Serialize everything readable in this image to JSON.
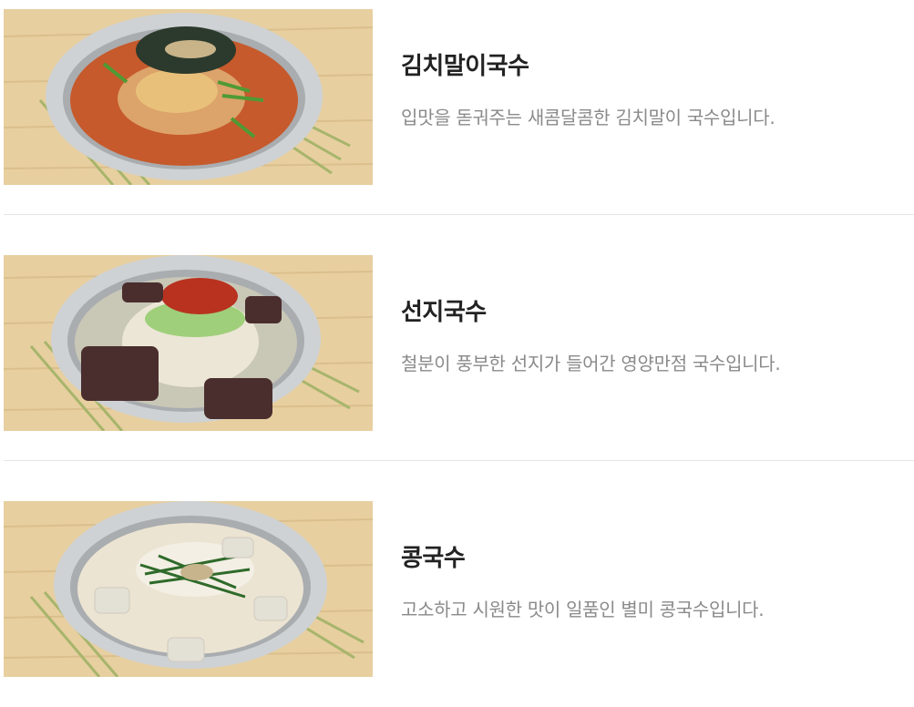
{
  "menu": {
    "items": [
      {
        "name": "김치말이국수",
        "description": "입맛을 돋궈주는 새콤달콤한 김치말이 국수입니다.",
        "image": "kimchi-mari-noodle-photo"
      },
      {
        "name": "선지국수",
        "description": "철분이 풍부한 선지가 들어간 영양만점 국수입니다.",
        "image": "seonji-noodle-photo"
      },
      {
        "name": "콩국수",
        "description": "고소하고 시원한 맛이 일품인 별미 콩국수입니다.",
        "image": "soy-milk-noodle-photo"
      }
    ]
  }
}
